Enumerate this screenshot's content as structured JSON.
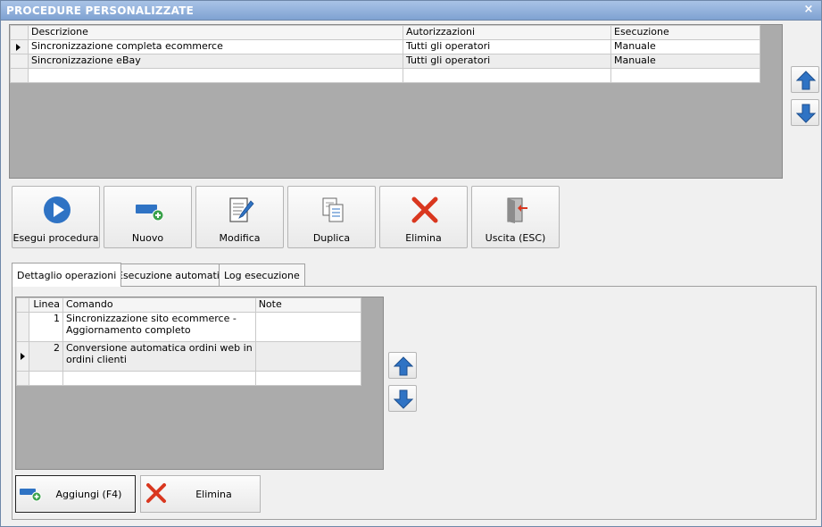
{
  "window": {
    "title": "PROCEDURE PERSONALIZZATE",
    "close_glyph": "×"
  },
  "procedures": {
    "columns": [
      "Descrizione",
      "Autorizzazioni",
      "Esecuzione"
    ],
    "rows": [
      {
        "descrizione": "Sincronizzazione completa ecommerce",
        "autorizzazioni": "Tutti gli operatori",
        "esecuzione": "Manuale",
        "current": true
      },
      {
        "descrizione": "Sincronizzazione eBay",
        "autorizzazioni": "Tutti gli operatori",
        "esecuzione": "Manuale",
        "current": false
      }
    ]
  },
  "toolbar": {
    "run_label": "Esegui procedura",
    "new_label": "Nuovo",
    "edit_label": "Modifica",
    "duplicate_label": "Duplica",
    "delete_label": "Elimina",
    "exit_label": "Uscita (ESC)"
  },
  "tabs": [
    {
      "label": "Dettaglio operazioni",
      "active": true
    },
    {
      "label": "Esecuzione automatica",
      "active": false
    },
    {
      "label": "Log esecuzione",
      "active": false
    }
  ],
  "operations": {
    "columns": [
      "Linea",
      "Comando",
      "Note"
    ],
    "rows": [
      {
        "linea": "1",
        "comando_l1": "Sincronizzazione sito ecommerce -",
        "comando_l2": "Aggiornamento completo",
        "note": "",
        "current": false
      },
      {
        "linea": "2",
        "comando_l1": "Conversione automatica ordini web in",
        "comando_l2": "ordini clienti",
        "note": "",
        "current": true
      }
    ]
  },
  "bottom": {
    "add_label": "Aggiungi (F4)",
    "delete_label": "Elimina"
  },
  "icons": {
    "play": "play-circle-icon",
    "new": "add-item-icon",
    "edit": "edit-document-icon",
    "duplicate": "duplicate-icon",
    "delete": "delete-x-icon",
    "exit": "exit-door-icon",
    "up": "arrow-up-icon",
    "down": "arrow-down-icon"
  },
  "colors": {
    "title_bar": "#7fa2d2",
    "accent_blue": "#2f73c4",
    "delete_red": "#d9371f",
    "grid_bg": "#ababab"
  }
}
